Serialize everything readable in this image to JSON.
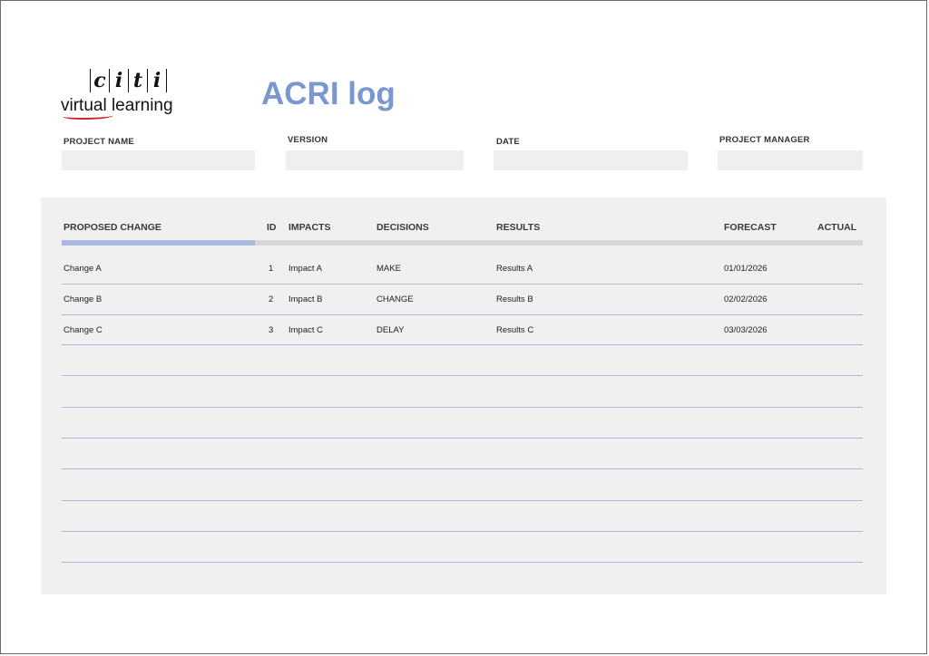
{
  "logo": {
    "letters": [
      "c",
      "i",
      "t",
      "i"
    ],
    "subtitle": "virtual learning"
  },
  "title": "ACRI log",
  "fields": {
    "project_name": {
      "label": "PROJECT NAME",
      "value": ""
    },
    "version": {
      "label": "VERSION",
      "value": ""
    },
    "date": {
      "label": "DATE",
      "value": ""
    },
    "project_manager": {
      "label": "PROJECT MANAGER",
      "value": ""
    }
  },
  "table": {
    "headers": {
      "proposed_change": "PROPOSED CHANGE",
      "id": "ID",
      "impacts": "IMPACTS",
      "decisions": "DECISIONS",
      "results": "RESULTS",
      "forecast": "FORECAST",
      "actual": "ACTUAL"
    },
    "rows": [
      {
        "change": "Change A",
        "id": "1",
        "impact": "Impact A",
        "decision": "MAKE",
        "result": "Results A",
        "forecast": "01/01/2026",
        "actual": ""
      },
      {
        "change": "Change B",
        "id": "2",
        "impact": "Impact B",
        "decision": "CHANGE",
        "result": "Results B",
        "forecast": "02/02/2026",
        "actual": ""
      },
      {
        "change": "Change C",
        "id": "3",
        "impact": "Impact C",
        "decision": "DELAY",
        "result": "Results C",
        "forecast": "03/03/2026",
        "actual": ""
      }
    ]
  },
  "colors": {
    "title": "#7b97cf",
    "accent_bar": "#aab9df",
    "rule": "#a9b9d8",
    "panel": "#f0f0f0"
  }
}
